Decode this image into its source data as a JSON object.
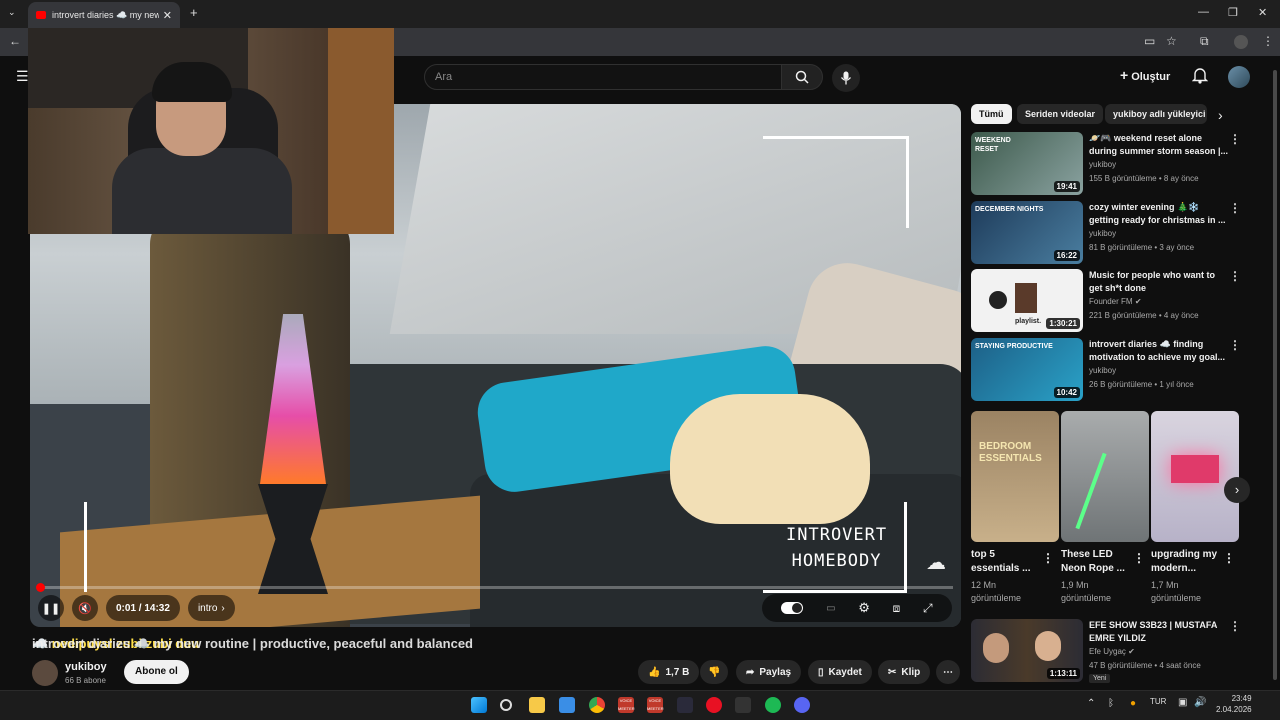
{
  "browser": {
    "tab_title": "introvert diaries ☁️ my new routine | productive, peaceful and balanced",
    "tab_close": "✕",
    "new_tab": "+",
    "window_controls": [
      "—",
      "❐",
      "✕"
    ]
  },
  "yt_header": {
    "menu_icon": "☰",
    "search_placeholder": "Ara",
    "create_label": "Oluştur"
  },
  "player": {
    "time": "0:01 / 14:32",
    "chapter": "intro",
    "progress_fraction": 0.001,
    "overlay_line1": "INTROVERT",
    "overlay_line2": "HOMEBODY"
  },
  "video": {
    "title_overlap": "☁️ nedipuysl zubi zubi duu",
    "title": "introvert diaries ☁️ my new routine | productive, peaceful and balanced",
    "channel": "yukiboy",
    "subscribers": "66 B abone",
    "subscribe_label": "Abone ol",
    "likes": "1,7 B",
    "share_label": "Paylaş",
    "save_label": "Kaydet",
    "clip_label": "Klip",
    "more": "⋯"
  },
  "sidebar": {
    "chips": [
      "Tümü",
      "Seriden videolar",
      "yukiboy adlı yükleyici"
    ],
    "videos": [
      {
        "title": "🪐🎮 weekend reset alone during summer storm season |...",
        "channel": "yukiboy",
        "meta": "155 B görüntüleme • 8 ay önce",
        "duration": "19:41",
        "thumb_text": "WEEKEND RESET",
        "thumb_color": "#3d5a4c"
      },
      {
        "title": "cozy winter evening 🎄❄️ getting ready for christmas in ...",
        "channel": "yukiboy",
        "meta": "81 B görüntüleme • 3 ay önce",
        "duration": "16:22",
        "thumb_text": "DECEMBER NIGHTS",
        "thumb_color": "#1e3b5a"
      },
      {
        "title": "Music for people who want to get sh*t done",
        "channel": "Founder FM",
        "verified": "✔",
        "meta": "221 B görüntüleme • 4 ay önce",
        "duration": "1:30:21",
        "thumb_text": "playlist.",
        "thumb_color": "#f2f2f2"
      },
      {
        "title": "introvert diaries ☁️ finding motivation to achieve my goal...",
        "channel": "yukiboy",
        "meta": "26 B görüntüleme • 1 yıl önce",
        "duration": "10:42",
        "thumb_text": "STAYING PRODUCTIVE",
        "thumb_color": "#1d5f86"
      }
    ],
    "shorts": [
      {
        "title": "top 5 essentials ...",
        "views": "12 Mn görüntüleme",
        "thumb_text": "BEDROOM ESSENTIALS",
        "thumb_color": "#9b8363"
      },
      {
        "title": "These LED Neon Rope ...",
        "views": "1,9 Mn görüntüleme",
        "thumb_text": "",
        "thumb_color": "#a9acad"
      },
      {
        "title": "upgrading my modern...",
        "views": "1,7 Mn görüntüleme",
        "thumb_text": "",
        "thumb_color": "#d9d4df"
      }
    ],
    "bottom_video": {
      "title": "EFE SHOW S3B23 | MUSTAFA EMRE YILDIZ",
      "channel": "Efe Uygaç",
      "verified": "✔",
      "meta": "47 B görüntüleme • 4 saat önce",
      "badge": "Yeni",
      "duration": "1:13:11",
      "thumb_color": "#2c2c34"
    }
  },
  "taskbar": {
    "lang": "TUR",
    "time": "23:49",
    "date": "2.04.2026",
    "tray_arrow": "⌃",
    "app1_label": "VOICE MEETER",
    "app2_label": "VOICE MEETER"
  },
  "colors": {
    "accent": "#ff0000",
    "background": "#0f0f0f"
  }
}
